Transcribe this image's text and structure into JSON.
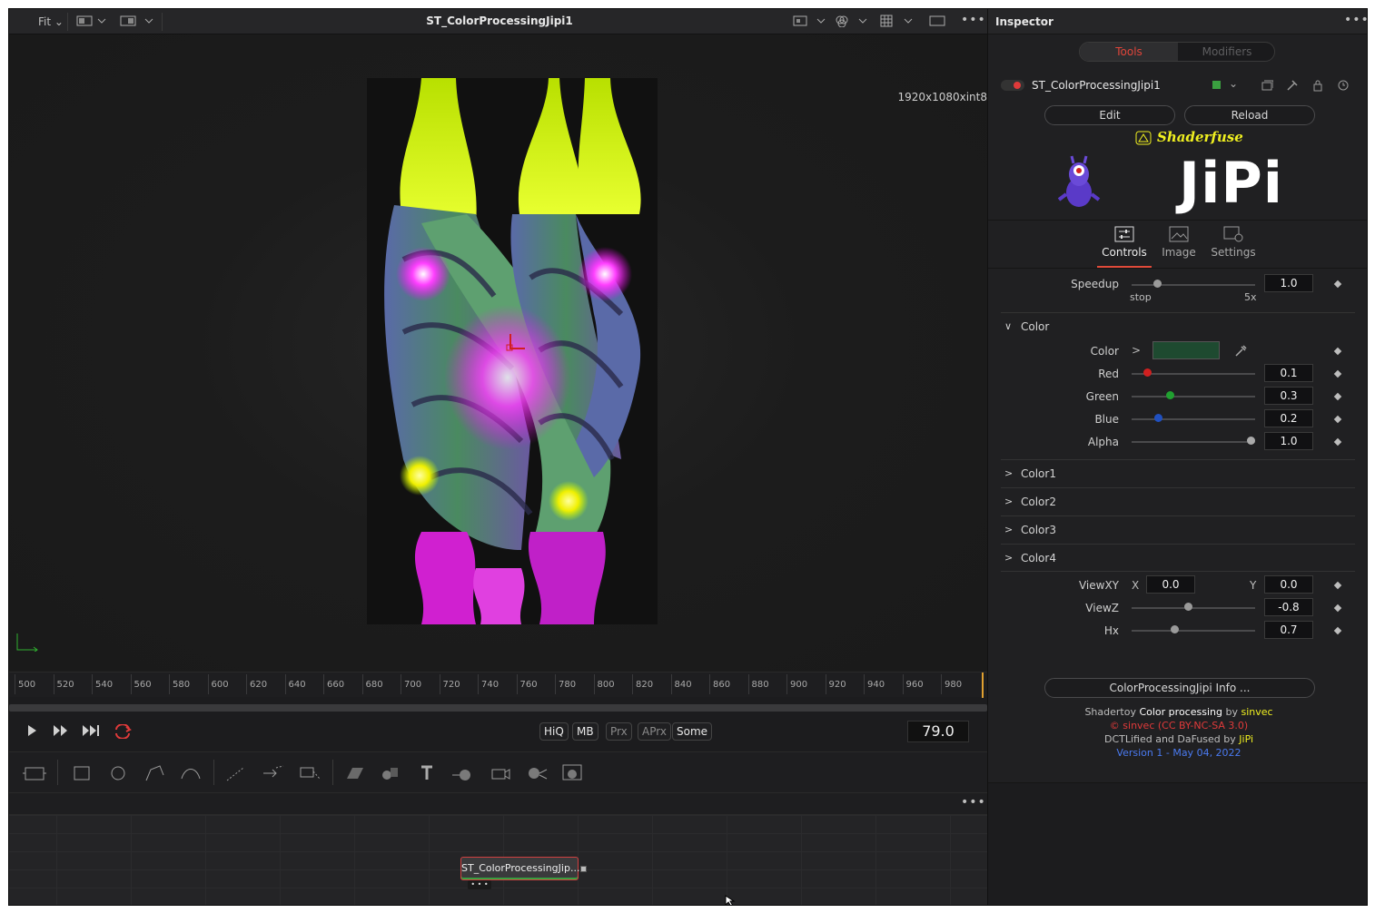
{
  "viewer": {
    "zoom_label": "Fit",
    "title": "ST_ColorProcessingJipi1",
    "resolution": "1920x1080xint8",
    "more_label": "•••"
  },
  "ruler": {
    "ticks": [
      "500",
      "520",
      "540",
      "560",
      "580",
      "600",
      "620",
      "640",
      "660",
      "680",
      "700",
      "720",
      "740",
      "760",
      "780",
      "800",
      "820",
      "840",
      "860",
      "880",
      "900",
      "920",
      "940",
      "960",
      "980"
    ]
  },
  "transport": {
    "hiq": "HiQ",
    "mb": "MB",
    "prx": "Prx",
    "aprx": "APrx",
    "some": "Some",
    "current_frame": "79.0"
  },
  "node_editor": {
    "more_label": "•••",
    "node_label": "ST_ColorProcessingJip...",
    "node_inputs": "• • •"
  },
  "inspector": {
    "title": "Inspector",
    "more_label": "•••",
    "tab_tools": "Tools",
    "tab_modifiers": "Modifiers",
    "node_name": "ST_ColorProcessingJipi1",
    "edit_label": "Edit",
    "reload_label": "Reload",
    "shaderfuse_label": "Shaderfuse",
    "logo_text": "JiPi",
    "tabs": [
      {
        "label": "Controls"
      },
      {
        "label": "Image"
      },
      {
        "label": "Settings"
      }
    ],
    "speedup": {
      "label": "Speedup",
      "value": "1.0",
      "min_label": "stop",
      "max_label": "5x",
      "level": 0.2
    },
    "color_section": {
      "label": "Color",
      "color_label": "Color",
      "swatch_color": "#1e4a30",
      "red": {
        "label": "Red",
        "value": "0.1",
        "knob_color": "#d02020"
      },
      "green": {
        "label": "Green",
        "value": "0.3",
        "knob_color": "#20a030"
      },
      "blue": {
        "label": "Blue",
        "value": "0.2",
        "knob_color": "#2050c0"
      },
      "alpha": {
        "label": "Alpha",
        "value": "1.0",
        "knob_color": "#aaaaaa"
      }
    },
    "collapsed_sections": [
      "Color1",
      "Color2",
      "Color3",
      "Color4"
    ],
    "viewxy": {
      "label": "ViewXY",
      "x_label": "X",
      "x_value": "0.0",
      "y_label": "Y",
      "y_value": "0.0"
    },
    "viewz": {
      "label": "ViewZ",
      "value": "-0.8"
    },
    "hx": {
      "label": "Hx",
      "value": "0.7"
    },
    "info_button": "ColorProcessingJipi Info ...",
    "credits": {
      "line1_a": "Shadertoy ",
      "line1_b": "Color processing",
      "line1_c": " by ",
      "line1_d": "sinvec",
      "line2": "© sinvec (CC BY-NC-SA 3.0)",
      "line3_a": "DCTLified and DaFused by ",
      "line3_b": "JiPi",
      "line4": "Version 1 - May 04, 2022"
    },
    "colors": {
      "accent_red": "#e04a3a",
      "credit_yellow": "#f0f020",
      "credit_red": "#e03a3a",
      "credit_blue": "#4a7af0",
      "node_color_green": "#3aa040"
    }
  }
}
